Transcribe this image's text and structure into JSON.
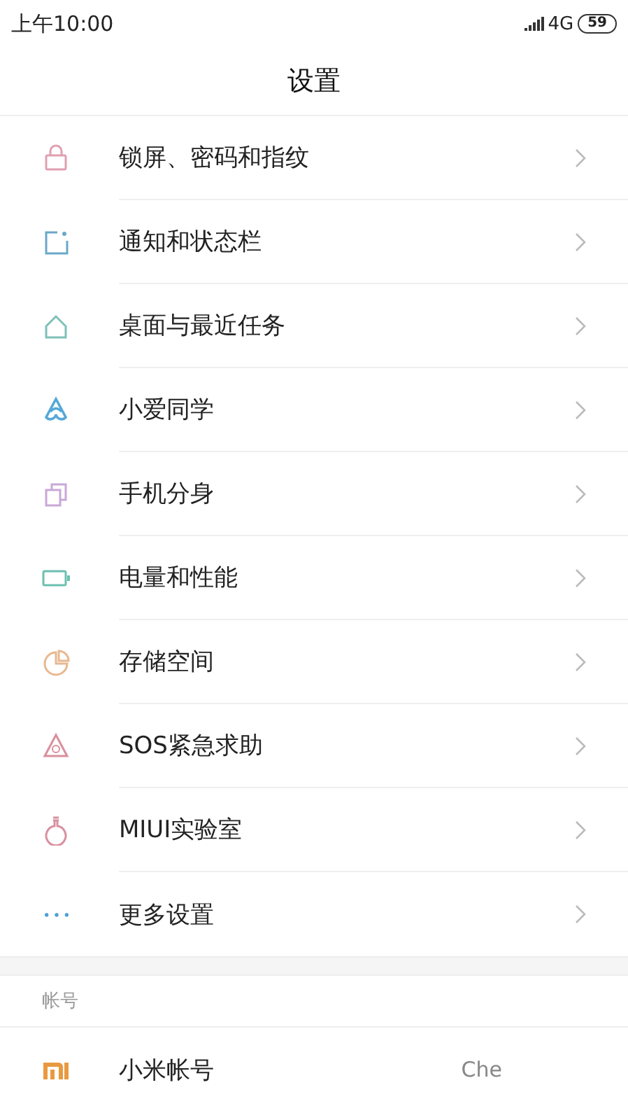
{
  "status_bar": {
    "time": "上午10:00",
    "network": "4G",
    "battery": "59"
  },
  "title": "设置",
  "items": [
    {
      "kind": "lock",
      "label": "锁屏、密码和指纹"
    },
    {
      "kind": "notification",
      "label": "通知和状态栏"
    },
    {
      "kind": "home",
      "label": "桌面与最近任务"
    },
    {
      "kind": "assistant",
      "label": "小爱同学"
    },
    {
      "kind": "clone",
      "label": "手机分身"
    },
    {
      "kind": "battery",
      "label": "电量和性能"
    },
    {
      "kind": "storage",
      "label": "存储空间"
    },
    {
      "kind": "sos",
      "label": "SOS紧急求助"
    },
    {
      "kind": "lab",
      "label": "MIUI实验室"
    },
    {
      "kind": "more",
      "label": "更多设置"
    }
  ],
  "account_section": {
    "header": "帐号",
    "items": [
      {
        "kind": "logo",
        "label": "小米帐号",
        "value": "Che"
      }
    ]
  }
}
